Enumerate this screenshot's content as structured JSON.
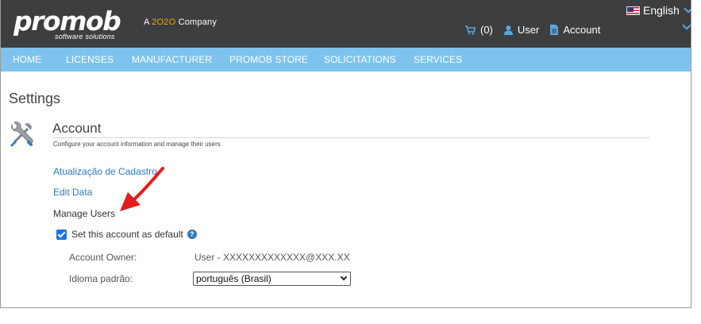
{
  "header": {
    "logo_text": "promob",
    "logo_subtitle": "software solutions",
    "company_tagline_prefix": "A ",
    "company_tagline_mark": "2O2O",
    "company_tagline_suffix": " Company",
    "language": "English",
    "cart_label": "(0)",
    "user_label": "User",
    "account_label": "Account"
  },
  "nav": {
    "items": [
      "HOME",
      "LICENSES",
      "MANUFACTURER",
      "PROMOB STORE",
      "SOLICITATIONS",
      "SERVICES"
    ]
  },
  "main": {
    "page_title": "Settings",
    "section_title": "Account",
    "section_description": "Configure your account information and manage their users",
    "links": [
      "Atualização de Cadastro",
      "Edit Data",
      "Manage Users"
    ],
    "default_checkbox_label": "Set this account as default",
    "default_checkbox_checked": true,
    "account_owner_label": "Account Owner:",
    "account_owner_value": "User - XXXXXXXXXXXXX@XXX.XX",
    "language_label": "Idioma padrão:",
    "language_selected": "português (Brasil)"
  },
  "colors": {
    "topbar": "#3d3e40",
    "navbar": "#7dc3ee",
    "link": "#2e7ab8",
    "annotation_arrow": "#e31b1b"
  }
}
